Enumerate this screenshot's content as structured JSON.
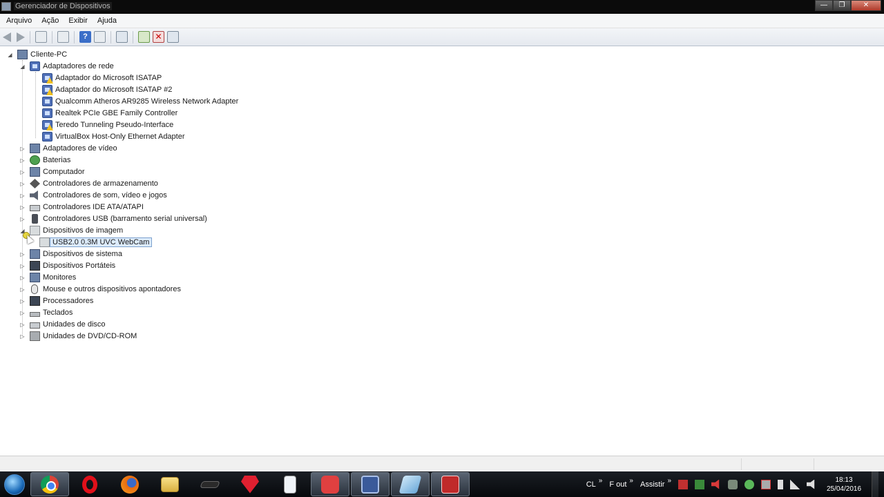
{
  "window": {
    "title": "Gerenciador de Dispositivos"
  },
  "menu": {
    "items": [
      "Arquivo",
      "Ação",
      "Exibir",
      "Ajuda"
    ]
  },
  "tree": {
    "root": "Cliente-PC",
    "items": [
      {
        "label": "Adaptadores de rede",
        "expander": "◢"
      },
      {
        "label": "Adaptador do Microsoft ISATAP"
      },
      {
        "label": "Adaptador do Microsoft ISATAP #2"
      },
      {
        "label": "Qualcomm Atheros AR9285 Wireless Network Adapter"
      },
      {
        "label": "Realtek PCIe GBE Family Controller"
      },
      {
        "label": "Teredo Tunneling Pseudo-Interface"
      },
      {
        "label": "VirtualBox Host-Only Ethernet Adapter"
      },
      {
        "label": "Adaptadores de vídeo",
        "expander": "▷"
      },
      {
        "label": "Baterias",
        "expander": "▷"
      },
      {
        "label": "Computador",
        "expander": "▷"
      },
      {
        "label": "Controladores de armazenamento",
        "expander": "▷"
      },
      {
        "label": "Controladores de som, vídeo e jogos",
        "expander": "▷"
      },
      {
        "label": "Controladores IDE ATA/ATAPI",
        "expander": "▷"
      },
      {
        "label": "Controladores USB (barramento serial universal)",
        "expander": "▷"
      },
      {
        "label": "Dispositivos de imagem",
        "expander": "◢"
      },
      {
        "label": "USB2.0 0.3M UVC WebCam"
      },
      {
        "label": "Dispositivos de sistema",
        "expander": "▷"
      },
      {
        "label": "Dispositivos Portáteis",
        "expander": "▷"
      },
      {
        "label": "Monitores",
        "expander": "▷"
      },
      {
        "label": "Mouse e outros dispositivos apontadores",
        "expander": "▷"
      },
      {
        "label": "Processadores",
        "expander": "▷"
      },
      {
        "label": "Teclados",
        "expander": "▷"
      },
      {
        "label": "Unidades de disco",
        "expander": "▷"
      },
      {
        "label": "Unidades de DVD/CD-ROM",
        "expander": "▷"
      }
    ]
  },
  "toolbar": {
    "help_label": "?",
    "uninstall_label": "✕"
  },
  "window_buttons": {
    "minimize": "—",
    "maximize": "❐",
    "close": "✕"
  },
  "tray": {
    "labels": [
      "CL",
      "F out",
      "Assistir"
    ],
    "chevron": "»",
    "time": "18:13",
    "date": "25/04/2016"
  },
  "colors": {
    "selection_bg": "#dcebfc",
    "selection_border": "#7da2ce",
    "taskbar": "#07090c"
  }
}
